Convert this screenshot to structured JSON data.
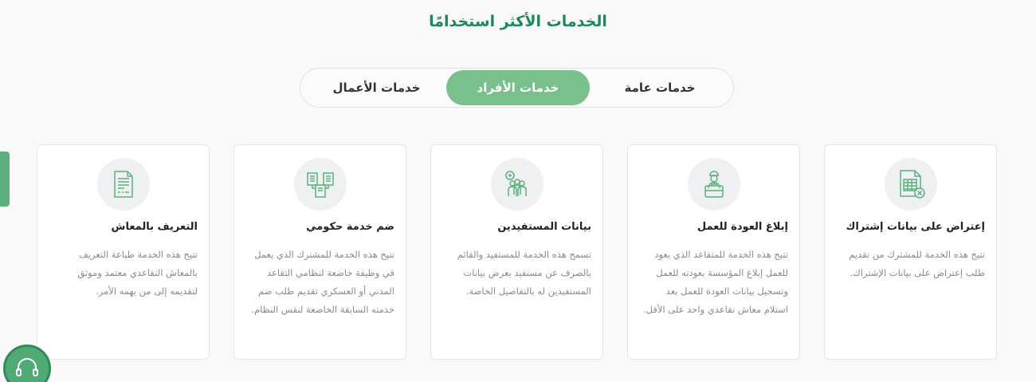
{
  "section": {
    "title": "الخدمات الأكثر استخدامًا"
  },
  "tabs": [
    {
      "label": "خدمات عامة"
    },
    {
      "label": "خدمات الأفراد",
      "active": true
    },
    {
      "label": "خدمات الأعمال"
    }
  ],
  "cards": [
    {
      "icon": "spreadsheet-x-icon",
      "title": "إعتراض على بيانات إشتراك",
      "description": "تتيح هذه الخدمة للمشترك من تقديم طلب إعتراض على بيانات الإشتراك."
    },
    {
      "icon": "worker-briefcase-icon",
      "title": "إبلاغ العودة للعمل",
      "description": "تتيح هذه الخدمة للمتقاعد الذي يعود للعمل إبلاغ المؤسسة بعودته للعمل وتسجيل بيانات العودة للعمل بعد استلام معاش تقاعدي واحد على الأقل."
    },
    {
      "icon": "beneficiaries-icon",
      "title": "بيانات المستفيدين",
      "description": "تسمح هذه الخدمة للمستفيد والقائم بالصرف عن مستفيد بعرض بيانات المستفيدين له بالتفاصيل الخاصة."
    },
    {
      "icon": "merge-documents-icon",
      "title": "ضم خدمة حكومي",
      "description": "تتيح هذه الخدمة للمشترك الذي يعمل في وظيفة خاضعة لنظامي التقاعد المدني أو العسكري تقديم طلب ضم خدمته السابقة الخاضعة لنفس النظام."
    },
    {
      "icon": "certificate-document-icon",
      "title": "التعريف بالمعاش",
      "description": "تتيح هذه الخدمة طباعة التعريف بالمعاش التقاعدي معتمد وموثق لتقديمه إلى من يهمه الأمر."
    }
  ],
  "support": {
    "icon": "headset-icon"
  },
  "colors": {
    "brand_green": "#1b8a5a",
    "active_tab": "#79c08d",
    "icon_stroke": "#5cb07d"
  }
}
